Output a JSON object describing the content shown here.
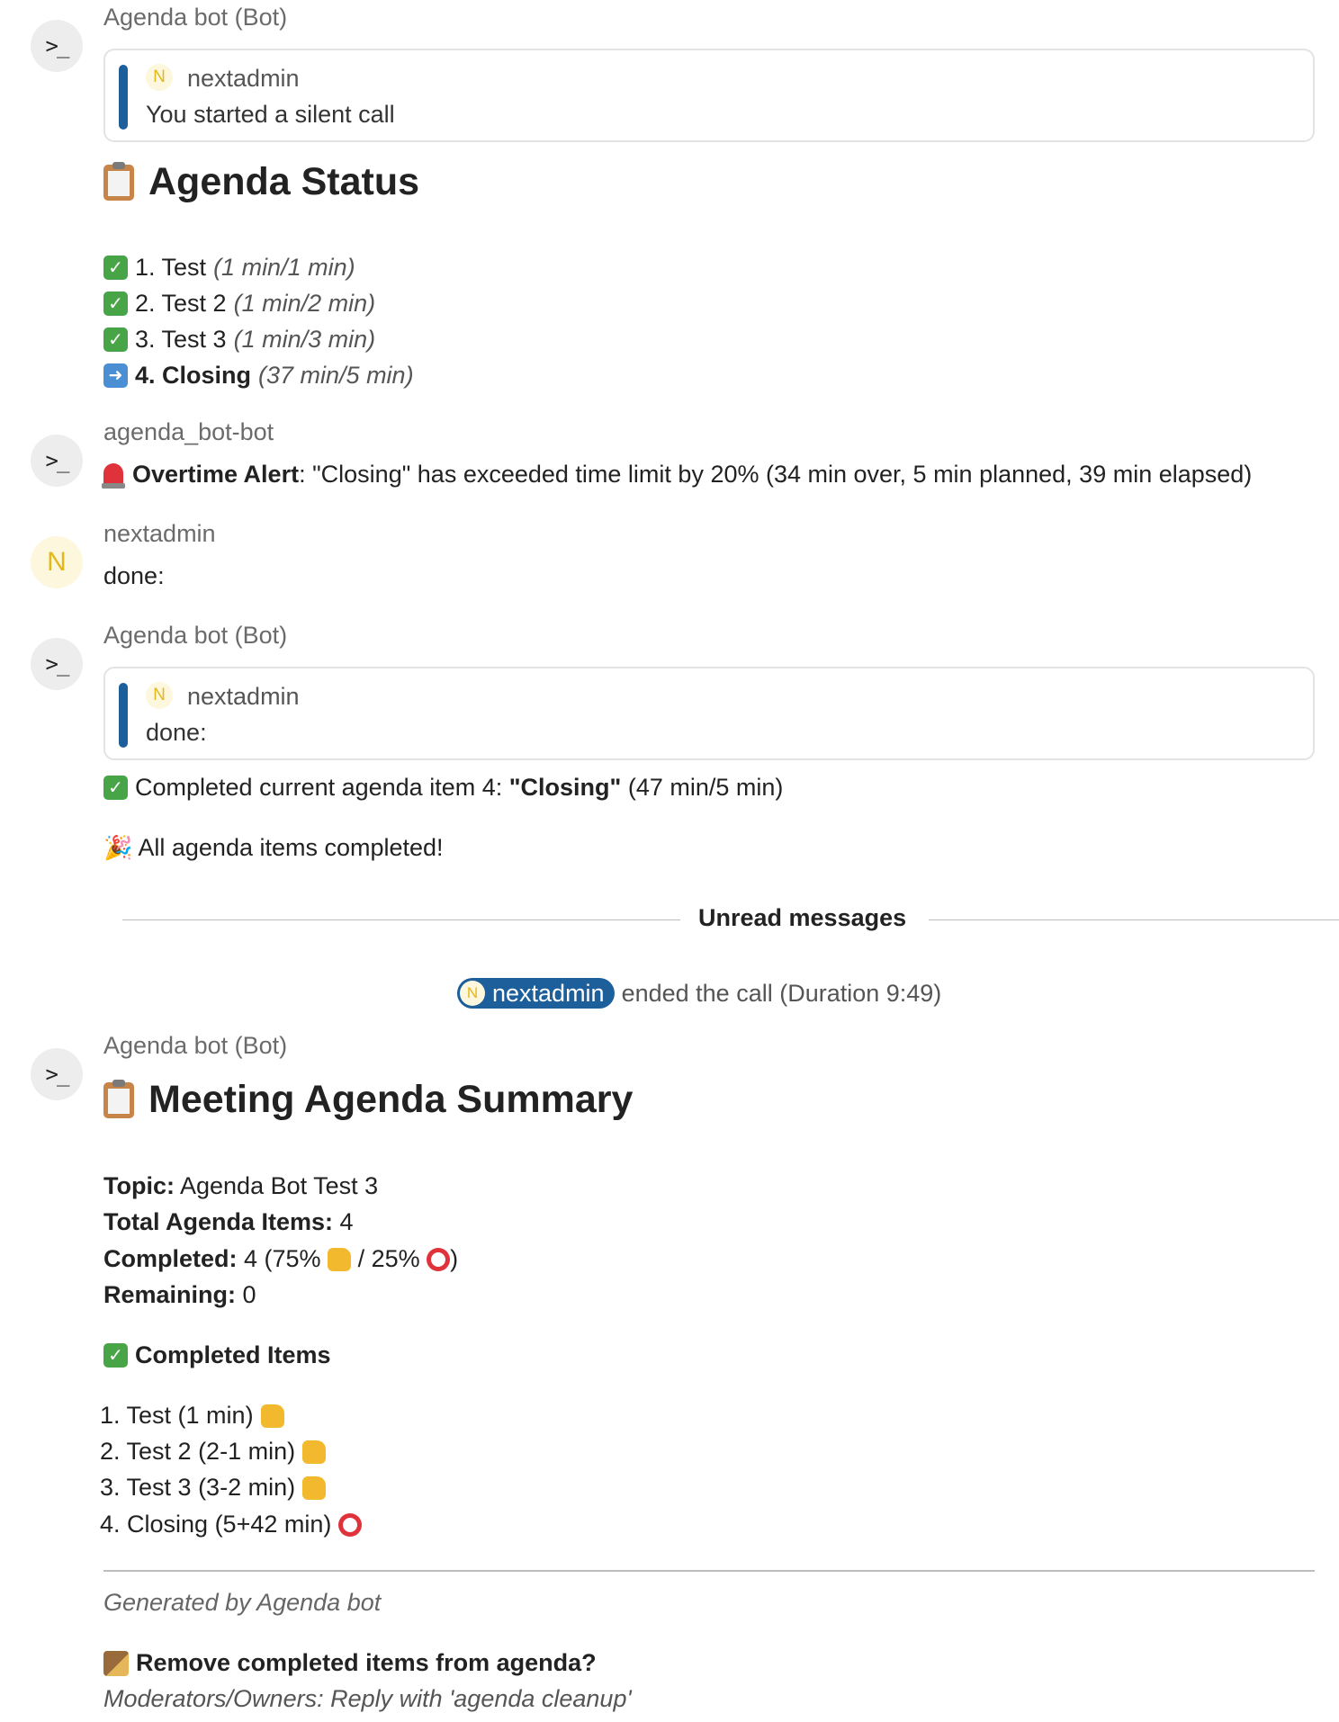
{
  "messages": {
    "m1": {
      "avatar": ">_",
      "author": "Agenda bot (Bot)",
      "quote": {
        "avatar": "N",
        "name": "nextadmin",
        "text": "You started a silent call"
      },
      "heading": "Agenda Status",
      "items": [
        {
          "label": "1. Test",
          "time": "(1 min/1 min)",
          "status": "done"
        },
        {
          "label": "2. Test 2",
          "time": "(1 min/2 min)",
          "status": "done"
        },
        {
          "label": "3. Test 3",
          "time": "(1 min/3 min)",
          "status": "done"
        },
        {
          "label": "4. Closing",
          "time": "(37 min/5 min)",
          "status": "current"
        }
      ]
    },
    "m2": {
      "avatar": ">_",
      "author": "agenda_bot-bot",
      "alert_label": "Overtime Alert",
      "alert_text": ": \"Closing\" has exceeded time limit by 20% (34 min over, 5 min planned, 39 min elapsed)"
    },
    "m3": {
      "avatar": "N",
      "author": "nextadmin",
      "text": "done:"
    },
    "m4": {
      "avatar": ">_",
      "author": "Agenda bot (Bot)",
      "quote": {
        "avatar": "N",
        "name": "nextadmin",
        "text": "done:"
      },
      "completed_prefix": "Completed current agenda item 4: ",
      "completed_item": "\"Closing\"",
      "completed_suffix": " (47 min/5 min)",
      "all_done": "All agenda items completed!"
    },
    "divider": "Unread messages",
    "system": {
      "avatar": "N",
      "user": "nextadmin",
      "text": "ended the call (Duration 9:49)"
    },
    "m5": {
      "avatar": ">_",
      "author": "Agenda bot (Bot)",
      "heading": "Meeting Agenda Summary",
      "topic_label": "Topic:",
      "topic_value": " Agenda Bot Test 3",
      "total_label": "Total Agenda Items:",
      "total_value": " 4",
      "completed_label": "Completed:",
      "completed_value_a": " 4 (75% ",
      "completed_value_b": " / 25% ",
      "completed_value_c": ")",
      "remaining_label": "Remaining:",
      "remaining_value": " 0",
      "completed_heading": "Completed Items",
      "list": [
        {
          "text": "1. Test (1 min)",
          "icon": "thumbs-up"
        },
        {
          "text": "2. Test 2 (2-1 min)",
          "icon": "thumbs-up"
        },
        {
          "text": "3. Test 3 (3-2 min)",
          "icon": "thumbs-up"
        },
        {
          "text": "4. Closing (5+42 min)",
          "icon": "alarm-clock"
        }
      ],
      "footer": "Generated by Agenda bot",
      "cleanup_title": "Remove completed items from agenda?",
      "cleanup_hint": "Moderators/Owners: Reply with 'agenda cleanup'"
    }
  }
}
